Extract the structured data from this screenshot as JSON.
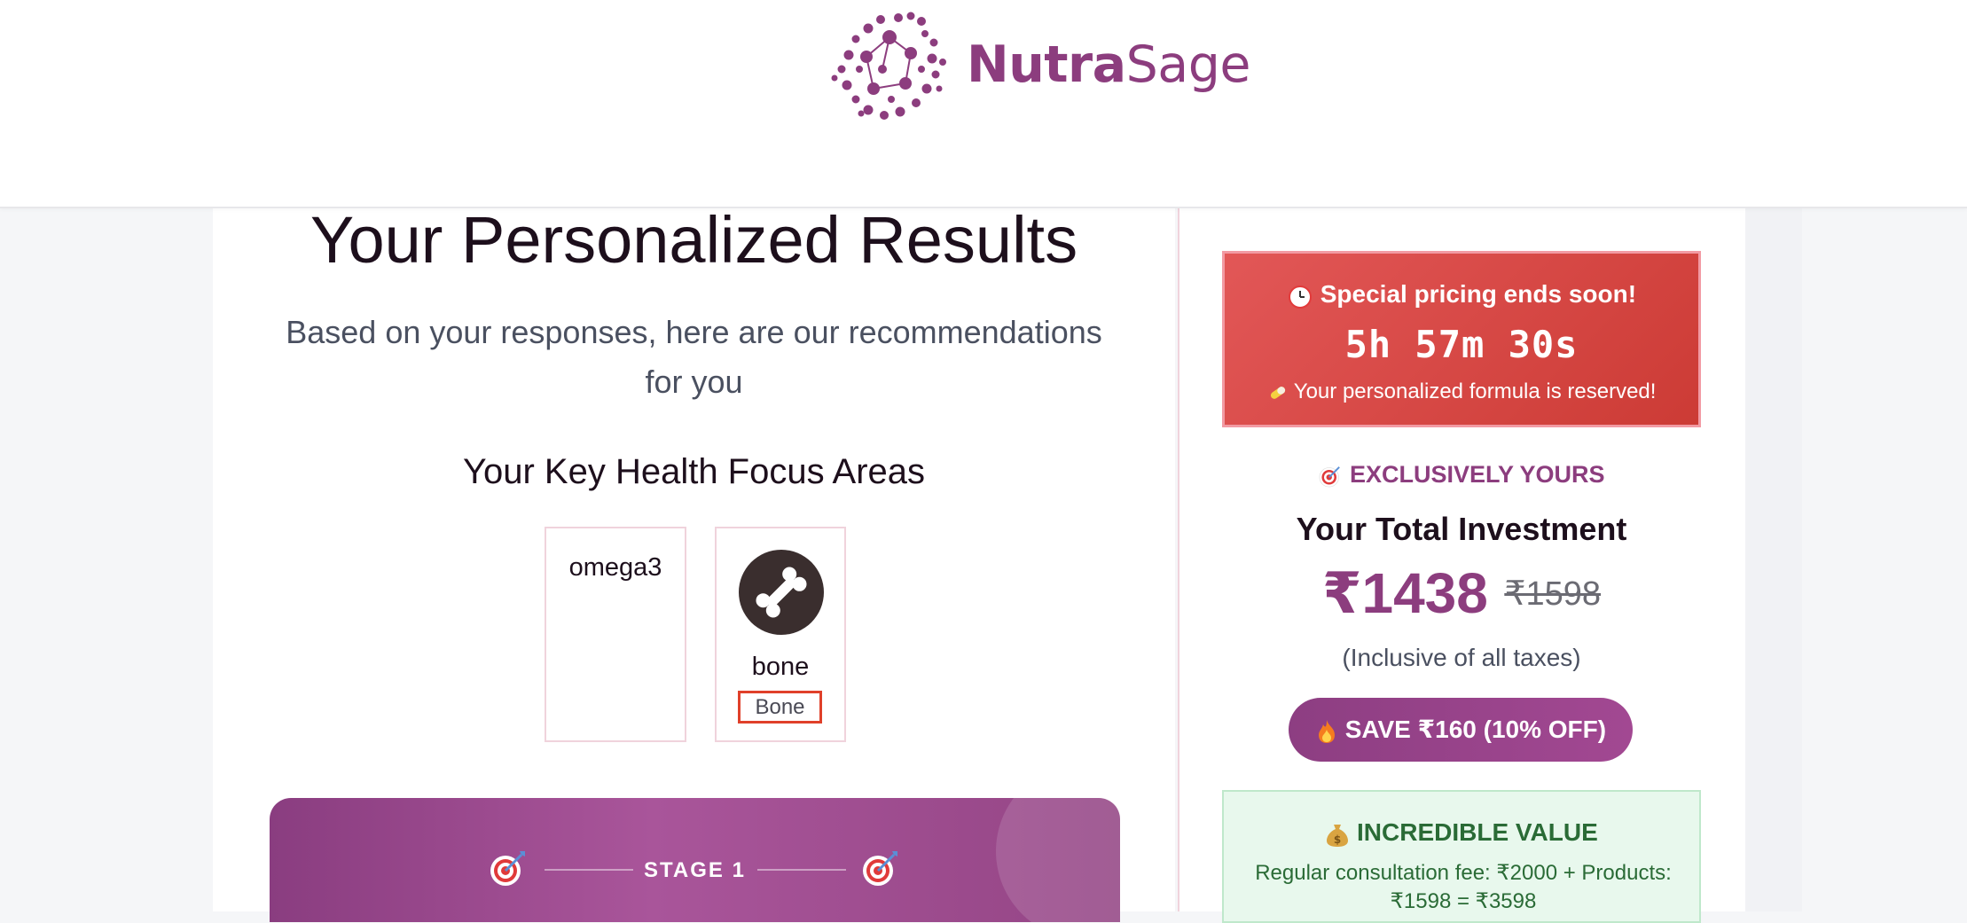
{
  "brand": {
    "name_part1": "Nutra",
    "name_part2": "Sage",
    "logo_icon": "molecule-dots-icon",
    "color": "#8c3d7e"
  },
  "results": {
    "title": "Your Personalized Results",
    "subtitle": "Based on your responses, here are our recommendations for you"
  },
  "focus_areas": {
    "heading": "Your Key Health Focus Areas",
    "items": [
      {
        "title": "omega3"
      },
      {
        "title": "bone",
        "icon": "bone-icon",
        "badge": "Bone"
      }
    ]
  },
  "stage": {
    "label": "STAGE 1",
    "icon": "target-dart-icon"
  },
  "urgency": {
    "icon": "alarm-clock-icon",
    "headline": "Special pricing ends soon!",
    "timer": "5h 57m 30s",
    "pill_icon": "pill-icon",
    "note": "Your personalized formula is reserved!"
  },
  "offer": {
    "tag_icon": "target-dart-icon",
    "tag": "EXCLUSIVELY YOURS",
    "title": "Your Total Investment",
    "price": "₹1438",
    "original_price": "₹1598",
    "taxes_note": "(Inclusive of all taxes)",
    "save_icon": "fire-icon",
    "save_label": "SAVE ₹160 (10% OFF)"
  },
  "value": {
    "icon": "money-bag-icon",
    "title": "INCREDIBLE VALUE",
    "text": "Regular consultation fee: ₹2000 + Products: ₹1598 = ₹3598"
  },
  "colors": {
    "primary": "#8c3d7e",
    "urgency_red": "#d84a46",
    "value_green": "#2a6b36",
    "value_bg": "#e8f8ed"
  }
}
